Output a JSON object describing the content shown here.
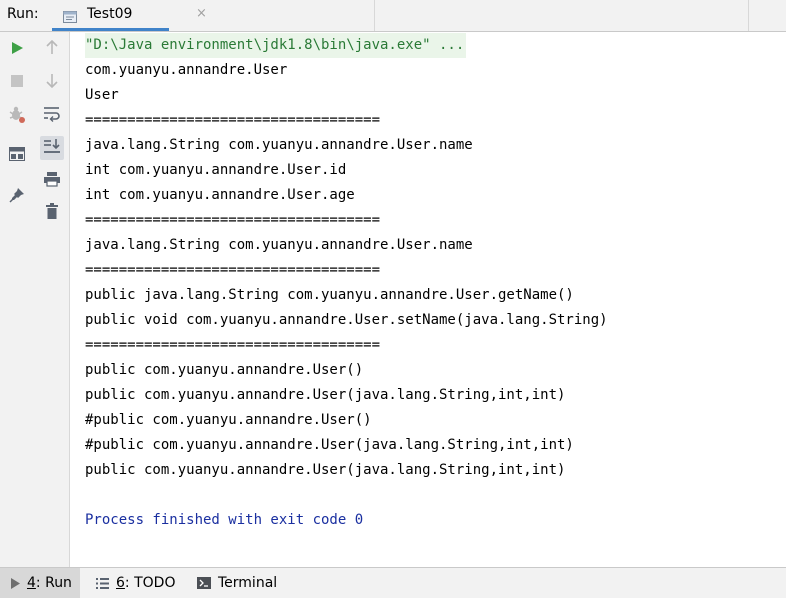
{
  "header": {
    "run_label": "Run:",
    "tab_title": "Test09",
    "tab_close": "×"
  },
  "left_toolbar": [
    {
      "icon": "run-play-icon",
      "name": "rerun"
    },
    {
      "icon": "stop-icon",
      "name": "stop"
    },
    {
      "icon": "debug-bug-icon",
      "name": "debug"
    },
    {
      "icon": "layout-icon",
      "name": "restore-layout"
    },
    {
      "icon": "pin-icon",
      "name": "pin-tab"
    }
  ],
  "right_toolbar": [
    {
      "icon": "arrow-up-icon",
      "name": "up-stack"
    },
    {
      "icon": "arrow-down-icon",
      "name": "down-stack"
    },
    {
      "icon": "soft-wrap-icon",
      "name": "soft-wrap"
    },
    {
      "icon": "scroll-to-end-icon",
      "name": "scroll-to-end"
    },
    {
      "icon": "print-icon",
      "name": "print"
    },
    {
      "icon": "trash-icon",
      "name": "clear-all"
    }
  ],
  "console": {
    "command": "\"D:\\Java environment\\jdk1.8\\bin\\java.exe\" ...",
    "lines": [
      "com.yuanyu.annandre.User",
      "User",
      "===================================",
      "java.lang.String com.yuanyu.annandre.User.name",
      "int com.yuanyu.annandre.User.id",
      "int com.yuanyu.annandre.User.age",
      "===================================",
      "java.lang.String com.yuanyu.annandre.User.name",
      "===================================",
      "public java.lang.String com.yuanyu.annandre.User.getName()",
      "public void com.yuanyu.annandre.User.setName(java.lang.String)",
      "===================================",
      "public com.yuanyu.annandre.User()",
      "public com.yuanyu.annandre.User(java.lang.String,int,int)",
      "#public com.yuanyu.annandre.User()",
      "#public com.yuanyu.annandre.User(java.lang.String,int,int)",
      "public com.yuanyu.annandre.User(java.lang.String,int,int)"
    ],
    "process_finished": "Process finished with exit code 0"
  },
  "bottom_bar": {
    "run": {
      "mnemonic": "4",
      "rest": ": Run"
    },
    "todo": {
      "mnemonic": "6",
      "rest": ": TODO"
    },
    "terminal": "Terminal"
  },
  "colors": {
    "accent": "#4083c9",
    "command_green": "#2a7a36",
    "process_blue": "#1a2fa0",
    "run_green": "#3ea046"
  }
}
